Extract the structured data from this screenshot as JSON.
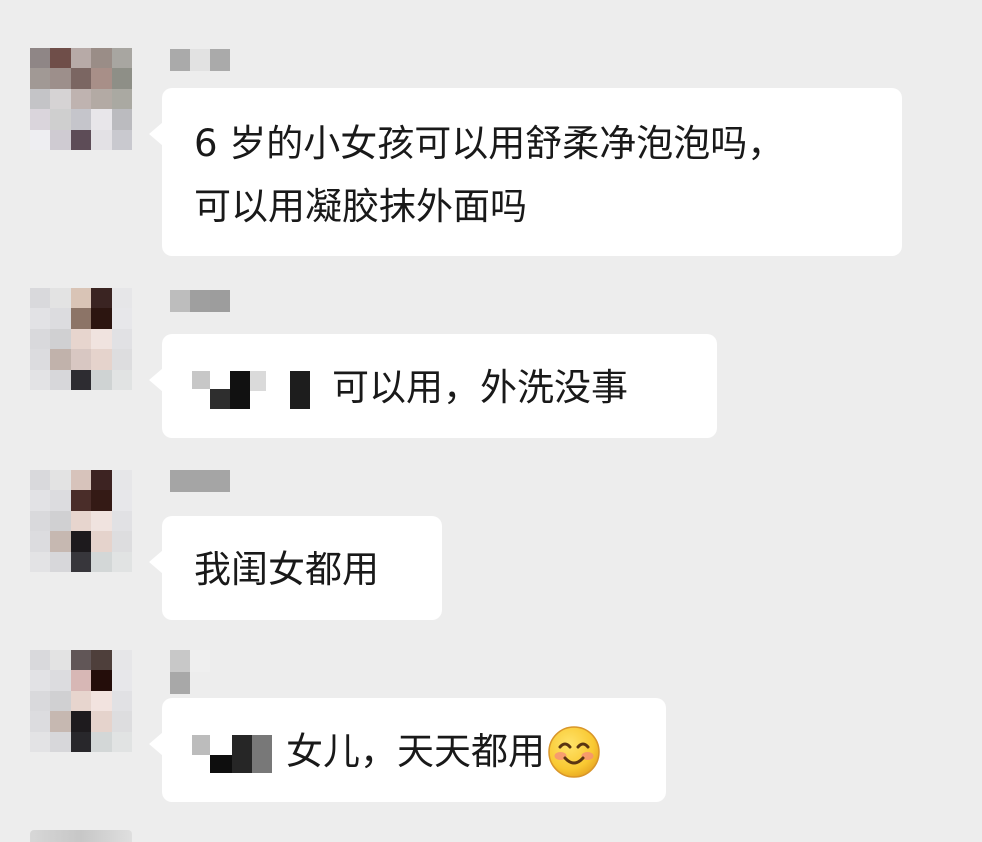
{
  "messages": [
    {
      "sender_avatar": "pixelated-avatar",
      "text_line_1": "6 岁的小女孩可以用舒柔净泡泡吗，",
      "text_line_2": "可以用凝胶抹外面吗"
    },
    {
      "sender_avatar": "pixelated-avatar",
      "text": "可以用，外洗没事"
    },
    {
      "sender_avatar": "pixelated-avatar",
      "text": "我闺女都用"
    },
    {
      "sender_avatar": "pixelated-avatar",
      "text": "女儿，天天都用",
      "emoji": "smiling-face-emoji"
    }
  ],
  "colors": {
    "background": "#ededed",
    "bubble": "#ffffff",
    "text": "#191919"
  }
}
